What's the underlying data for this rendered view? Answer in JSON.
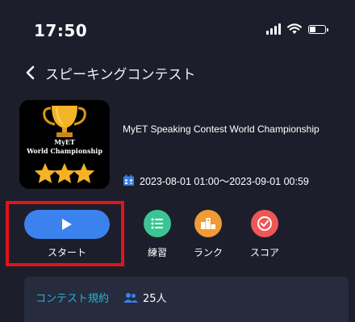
{
  "status_bar": {
    "time": "17:50",
    "icons": [
      "signal-icon",
      "wifi-icon",
      "battery-icon"
    ]
  },
  "nav": {
    "back_icon": "chevron-left-icon",
    "title": "スピーキングコンテスト"
  },
  "contest": {
    "logo_line1": "MyET",
    "logo_line2": "World Championship",
    "logo_icons": [
      "trophy-icon",
      "star-icon",
      "star-icon",
      "star-icon"
    ],
    "name": "MyET Speaking Contest   World Championship",
    "period_icon": "calendar-icon",
    "period": "2023-08-01 01:00～2023-09-01 00:59"
  },
  "actions": {
    "start": {
      "label": "スタート",
      "icon": "play-icon",
      "color": "#3b82ee"
    },
    "practice": {
      "label": "練習",
      "icon": "list-icon",
      "color": "#3cc593"
    },
    "ranking": {
      "label": "ランク",
      "icon": "podium-icon",
      "color": "#f19a36"
    },
    "score": {
      "label": "スコア",
      "icon": "check-circle-icon",
      "color": "#ef5656"
    }
  },
  "highlight_color": "#e0141b",
  "rules": {
    "label": "コンテスト規約",
    "label_color": "#23b7d3",
    "participants_icon": "users-icon",
    "participants": "25人"
  }
}
